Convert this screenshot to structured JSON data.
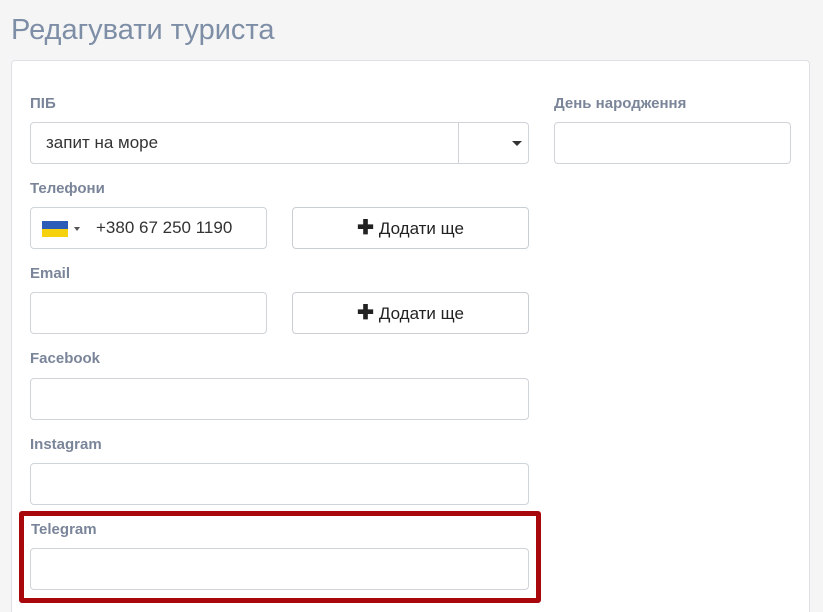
{
  "page": {
    "title": "Редагувати туриста"
  },
  "form": {
    "name": {
      "label": "ПІБ",
      "value": "запит на море"
    },
    "birthday": {
      "label": "День народження",
      "value": ""
    },
    "phones": {
      "label": "Телефони",
      "country_flag": "ukraine-flag",
      "value": "+380 67 250 1190",
      "add_button_label": "Додати ще"
    },
    "email": {
      "label": "Email",
      "value": "",
      "add_button_label": "Додати ще"
    },
    "facebook": {
      "label": "Facebook",
      "value": ""
    },
    "instagram": {
      "label": "Instagram",
      "value": ""
    },
    "telegram": {
      "label": "Telegram",
      "value": ""
    }
  },
  "colors": {
    "title": "#7d8ea6",
    "label": "#7a8599",
    "highlight": "#a8080c",
    "flag_blue": "#2b5db8",
    "flag_yellow": "#f5d10e"
  }
}
